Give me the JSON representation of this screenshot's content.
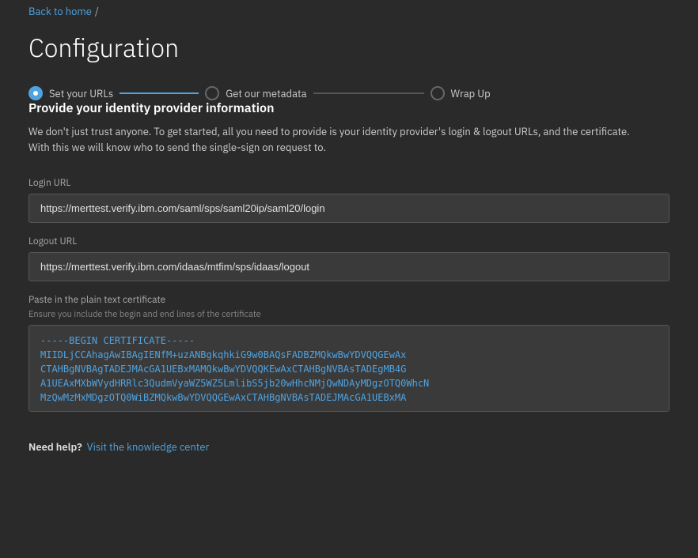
{
  "breadcrumb": {
    "back_label": "Back to home",
    "separator": "/"
  },
  "page": {
    "title": "Configuration"
  },
  "stepper": {
    "steps": [
      {
        "label": "Set your URLs",
        "state": "active"
      },
      {
        "label": "Get our metadata",
        "state": "inactive"
      },
      {
        "label": "Wrap Up",
        "state": "inactive"
      }
    ]
  },
  "form": {
    "section_title": "Provide your identity provider information",
    "section_desc": "We don't just trust anyone. To get started, all you need to provide is your identity provider's login & logout URLs, and the certificate. With this we will know who to send the single-sign on request to.",
    "login_url": {
      "label": "Login URL",
      "value": "https://merttest.verify.ibm.com/saml/sps/saml20ip/saml20/login",
      "placeholder": ""
    },
    "logout_url": {
      "label": "Logout URL",
      "value": "https://merttest.verify.ibm.com/idaas/mtfim/sps/idaas/logout",
      "placeholder": ""
    },
    "certificate": {
      "label": "Paste in the plain text certificate",
      "hint": "Ensure you include the begin and end lines of the certificate",
      "value": "-----BEGIN CERTIFICATE-----\nMIIDLjCCAhagAwIBAgIENfM+uzANBgkqhkiG9w0BAQsFADBZMQkwBwYDVQQGEwAx\nCTAHBgNVBAgTADEJMAcGA1UEBxMAMQkwBwYDVQQKEwAxCTAHBgNVBAsTADEgMB4G\nA1UEAxMXbWVydHRRlc3QudmVyaWZ5WZ5LmlibS5jb20wHhcNMjQwNDAyMDgzOTQ0WhcN\nMzQwMzMxMDgzOTQ0WiBZMQkwBwYDVQQGEwAxCTAHBgNVBAsTADEJMAcGA1UEBxMA"
    }
  },
  "help": {
    "label": "Need help?",
    "link_text": "Visit the knowledge center"
  }
}
